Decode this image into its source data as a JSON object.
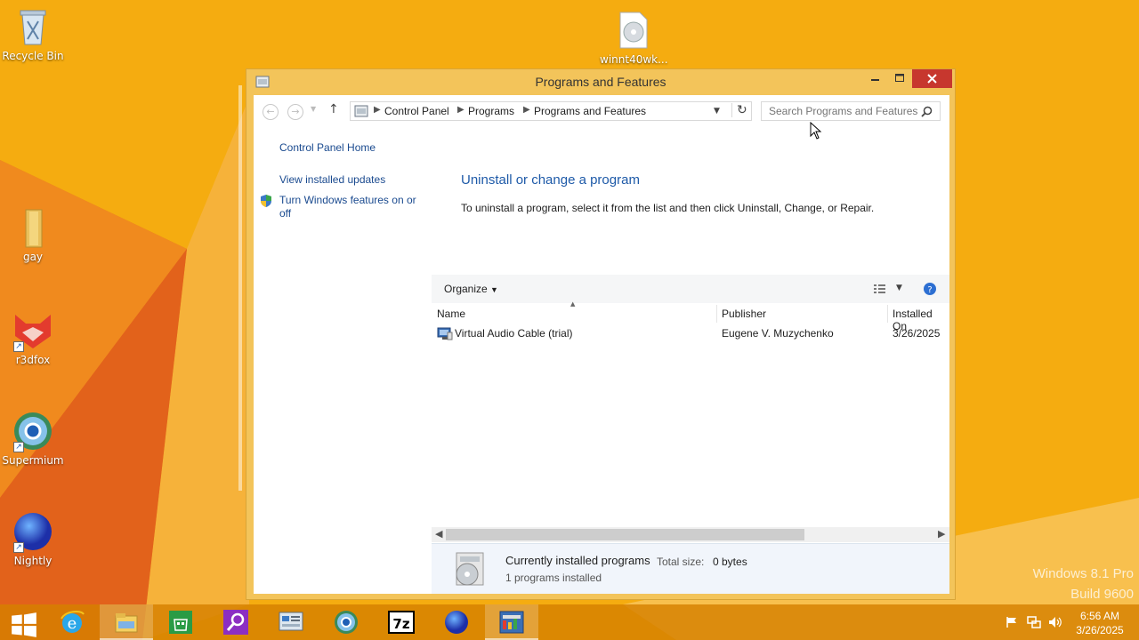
{
  "desktop": {
    "icons": [
      {
        "label": "Recycle Bin",
        "icon": "recycle-bin-icon"
      },
      {
        "label": "winnt40wk...",
        "icon": "disc-image-icon"
      },
      {
        "label": "gay",
        "icon": "folder-icon"
      },
      {
        "label": "r3dfox",
        "icon": "r3dfox-icon"
      },
      {
        "label": "Supermium",
        "icon": "supermium-icon"
      },
      {
        "label": "Nightly",
        "icon": "nightly-icon"
      }
    ],
    "watermark": {
      "line1": "Windows 8.1 Pro",
      "line2": "Build 9600"
    }
  },
  "window": {
    "title": "Programs and Features",
    "breadcrumb": [
      "Control Panel",
      "Programs",
      "Programs and Features"
    ],
    "search_placeholder": "Search Programs and Features",
    "left_pane": {
      "home": "Control Panel Home",
      "updates": "View installed updates",
      "features": "Turn Windows features on or off"
    },
    "heading": "Uninstall or change a program",
    "description": "To uninstall a program, select it from the list and then click Uninstall, Change, or Repair.",
    "toolbar": {
      "organize": "Organize"
    },
    "columns": {
      "name": "Name",
      "publisher": "Publisher",
      "installed_on": "Installed On"
    },
    "programs": [
      {
        "name": "Virtual Audio Cable (trial)",
        "publisher": "Eugene V. Muzychenko",
        "installed_on": "3/26/2025"
      }
    ],
    "details": {
      "title": "Currently installed programs",
      "total_size_label": "Total size:",
      "total_size_value": "0 bytes",
      "count": "1 programs installed"
    }
  },
  "taskbar": {
    "apps": [
      "start-icon",
      "internet-explorer-icon",
      "file-explorer-icon",
      "store-icon",
      "search-app-icon",
      "control-panel-icon",
      "supermium-icon",
      "7zip-icon",
      "nightly-icon",
      "audio-app-icon"
    ],
    "clock": {
      "time": "6:56 AM",
      "date": "3/26/2025"
    }
  }
}
